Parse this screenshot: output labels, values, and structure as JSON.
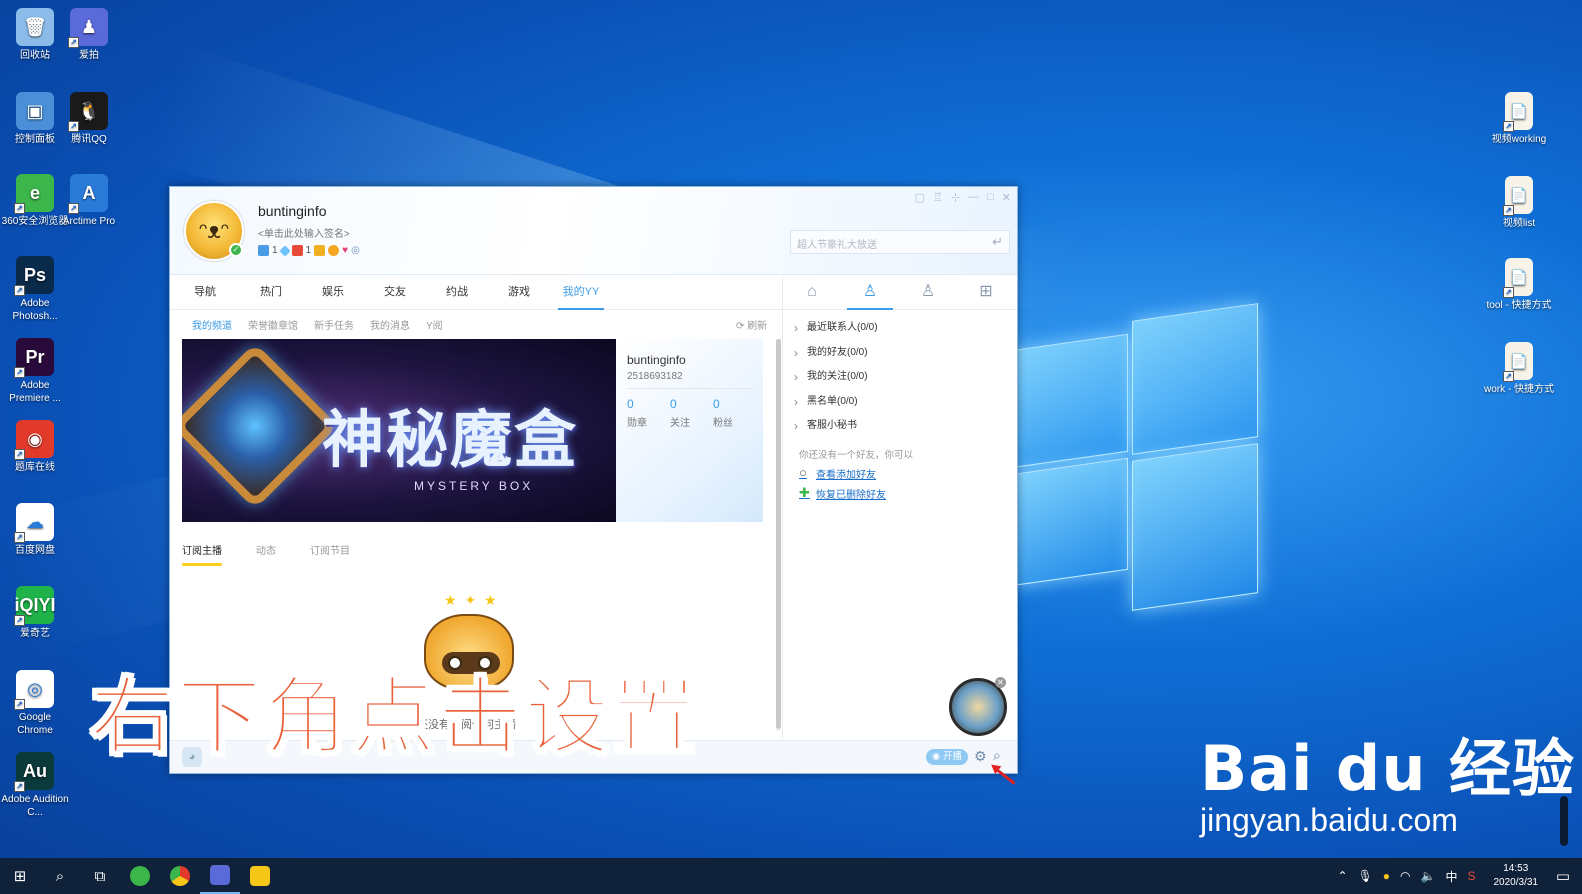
{
  "desktop": {
    "icons_left": [
      {
        "label": "回收站",
        "color": "#8bbbe8",
        "glyph": "🗑",
        "shortcut": false
      },
      {
        "label": "控制面板",
        "color": "#4a8fd8",
        "glyph": "▣",
        "shortcut": false
      },
      {
        "label": "360安全浏览器",
        "color": "#3cb54a",
        "glyph": "e",
        "shortcut": true
      },
      {
        "label": "Adobe Photosh...",
        "color": "#0a2a4a",
        "glyph": "Ps",
        "shortcut": true
      },
      {
        "label": "Adobe Premiere ...",
        "color": "#2a0a3a",
        "glyph": "Pr",
        "shortcut": true
      },
      {
        "label": "题库在线",
        "color": "#e23a2a",
        "glyph": "◉",
        "shortcut": true
      },
      {
        "label": "百度网盘",
        "color": "#ffffff",
        "glyph": "☁",
        "shortcut": true
      },
      {
        "label": "爱奇艺",
        "color": "#1fb34a",
        "glyph": "iQIYI",
        "shortcut": true
      },
      {
        "label": "Google Chrome",
        "color": "#ffffff",
        "glyph": "◎",
        "shortcut": true
      },
      {
        "label": "Adobe Audition C...",
        "color": "#0a3a3a",
        "glyph": "Au",
        "shortcut": true
      }
    ],
    "icons_second": [
      {
        "label": "爱拍",
        "color": "#5a6ad8",
        "glyph": "♟",
        "shortcut": true
      },
      {
        "label": "腾讯QQ",
        "color": "#1a1a1a",
        "glyph": "🐧",
        "shortcut": true
      },
      {
        "label": "Arctime Pro",
        "color": "#2a7ad8",
        "glyph": "A",
        "shortcut": true
      }
    ],
    "icons_right": [
      {
        "label": "视频working",
        "glyph": "📄"
      },
      {
        "label": "视频list",
        "glyph": "📄"
      },
      {
        "label": "tool - 快捷方式",
        "glyph": "📄"
      },
      {
        "label": "work - 快捷方式",
        "glyph": "📄"
      }
    ]
  },
  "yy": {
    "username": "buntinginfo",
    "signature": "<单击此处输入签名>",
    "badges": {
      "count_a": "1",
      "count_b": "1"
    },
    "search_placeholder": "超人节豪礼大放送",
    "tabs": [
      "导航",
      "热门",
      "娱乐",
      "交友",
      "约战",
      "游戏",
      "我的YY"
    ],
    "active_tab": "我的YY",
    "subnav": [
      "我的频道",
      "荣誉徽章馆",
      "新手任务",
      "我的消息",
      "Y阅"
    ],
    "refresh_label": "刷新",
    "banner": {
      "title": "神秘魔盒",
      "subtitle": "MYSTERY BOX"
    },
    "profile_card": {
      "name": "buntinginfo",
      "id": "2518693182",
      "stats": [
        {
          "value": "0",
          "label": "勋章"
        },
        {
          "value": "0",
          "label": "关注"
        },
        {
          "value": "0",
          "label": "粉丝"
        }
      ]
    },
    "content_tabs": [
      "订阅主播",
      "动态",
      "订阅节目"
    ],
    "empty_text": "您还没有订阅任何主播",
    "contacts": {
      "groups": [
        "最近联系人(0/0)",
        "我的好友(0/0)",
        "我的关注(0/0)",
        "黑名单(0/0)",
        "客服小秘书"
      ],
      "hint": "你还没有一个好友，你可以",
      "links": [
        "查看添加好友",
        "恢复已删除好友"
      ]
    },
    "bottom": {
      "live_label": "开播"
    }
  },
  "overlay": {
    "caption": "右下角点击设置"
  },
  "watermark": {
    "logo": "Bai du 经验",
    "url": "jingyan.baidu.com"
  },
  "taskbar": {
    "time": "14:53",
    "date": "2020/3/31",
    "ime": "中"
  }
}
